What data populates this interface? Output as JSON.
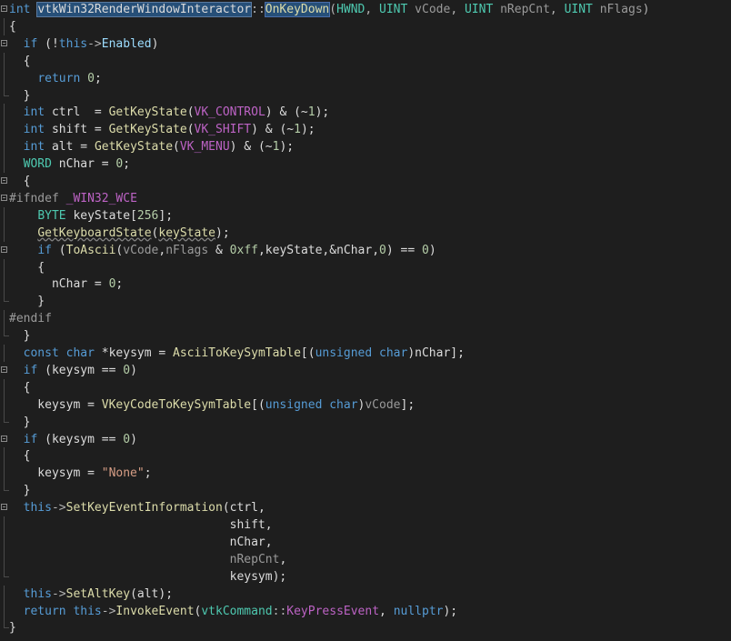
{
  "lines": [
    [
      [
        "kw",
        "int"
      ],
      [
        "plain",
        " "
      ],
      [
        "hlc",
        "vtkWin32RenderWindowInteractor"
      ],
      [
        "op",
        "::"
      ],
      [
        "hlf",
        "OnKeyDown"
      ],
      [
        "op",
        "("
      ],
      [
        "type",
        "HWND"
      ],
      [
        "op",
        ", "
      ],
      [
        "type",
        "UINT"
      ],
      [
        "param",
        " vCode"
      ],
      [
        "op",
        ", "
      ],
      [
        "type",
        "UINT"
      ],
      [
        "param",
        " nRepCnt"
      ],
      [
        "op",
        ", "
      ],
      [
        "type",
        "UINT"
      ],
      [
        "param",
        " nFlags"
      ],
      [
        "op",
        ")"
      ]
    ],
    [
      [
        "plain",
        "{"
      ]
    ],
    [
      [
        "plain",
        "  "
      ],
      [
        "kw",
        "if"
      ],
      [
        "plain",
        " (!"
      ],
      [
        "kw",
        "this"
      ],
      [
        "op",
        "->"
      ],
      [
        "var",
        "Enabled"
      ],
      [
        "plain",
        ")"
      ]
    ],
    [
      [
        "plain",
        "  {"
      ]
    ],
    [
      [
        "plain",
        "    "
      ],
      [
        "kw",
        "return"
      ],
      [
        "plain",
        " "
      ],
      [
        "num",
        "0"
      ],
      [
        "plain",
        ";"
      ]
    ],
    [
      [
        "plain",
        "  }"
      ]
    ],
    [
      [
        "plain",
        "  "
      ],
      [
        "kw",
        "int"
      ],
      [
        "plain",
        " ctrl  = "
      ],
      [
        "fn",
        "GetKeyState"
      ],
      [
        "plain",
        "("
      ],
      [
        "macro",
        "VK_CONTROL"
      ],
      [
        "plain",
        ") & (~"
      ],
      [
        "num",
        "1"
      ],
      [
        "plain",
        ");"
      ]
    ],
    [
      [
        "plain",
        "  "
      ],
      [
        "kw",
        "int"
      ],
      [
        "plain",
        " shift = "
      ],
      [
        "fn",
        "GetKeyState"
      ],
      [
        "plain",
        "("
      ],
      [
        "macro",
        "VK_SHIFT"
      ],
      [
        "plain",
        ") & (~"
      ],
      [
        "num",
        "1"
      ],
      [
        "plain",
        ");"
      ]
    ],
    [
      [
        "plain",
        "  "
      ],
      [
        "kw",
        "int"
      ],
      [
        "plain",
        " alt = "
      ],
      [
        "fn",
        "GetKeyState"
      ],
      [
        "plain",
        "("
      ],
      [
        "macro",
        "VK_MENU"
      ],
      [
        "plain",
        ") & (~"
      ],
      [
        "num",
        "1"
      ],
      [
        "plain",
        ");"
      ]
    ],
    [
      [
        "plain",
        "  "
      ],
      [
        "type",
        "WORD"
      ],
      [
        "plain",
        " nChar = "
      ],
      [
        "num",
        "0"
      ],
      [
        "plain",
        ";"
      ]
    ],
    [
      [
        "plain",
        "  {"
      ]
    ],
    [
      [
        "pp",
        "#ifndef"
      ],
      [
        "plain",
        " "
      ],
      [
        "macro",
        "_WIN32_WCE"
      ]
    ],
    [
      [
        "plain",
        "    "
      ],
      [
        "type",
        "BYTE"
      ],
      [
        "plain",
        " keyState["
      ],
      [
        "num",
        "256"
      ],
      [
        "plain",
        "];"
      ]
    ],
    [
      [
        "plain",
        "    "
      ],
      [
        "sq",
        "GetKeyboardState"
      ],
      [
        "plain",
        "("
      ],
      [
        "sq",
        "keyState"
      ],
      [
        "plain",
        ");"
      ]
    ],
    [
      [
        "plain",
        "    "
      ],
      [
        "kw",
        "if"
      ],
      [
        "plain",
        " ("
      ],
      [
        "fn",
        "ToAscii"
      ],
      [
        "plain",
        "("
      ],
      [
        "param",
        "vCode"
      ],
      [
        "plain",
        ","
      ],
      [
        "param",
        "nFlags"
      ],
      [
        "plain",
        " & "
      ],
      [
        "num",
        "0xff"
      ],
      [
        "plain",
        ",keyState,&nChar,"
      ],
      [
        "num",
        "0"
      ],
      [
        "plain",
        ") == "
      ],
      [
        "num",
        "0"
      ],
      [
        "plain",
        ")"
      ]
    ],
    [
      [
        "plain",
        "    {"
      ]
    ],
    [
      [
        "plain",
        "      nChar = "
      ],
      [
        "num",
        "0"
      ],
      [
        "plain",
        ";"
      ]
    ],
    [
      [
        "plain",
        "    }"
      ]
    ],
    [
      [
        "pp",
        "#endif"
      ]
    ],
    [
      [
        "plain",
        "  }"
      ]
    ],
    [
      [
        "plain",
        "  "
      ],
      [
        "kw",
        "const"
      ],
      [
        "plain",
        " "
      ],
      [
        "kw",
        "char"
      ],
      [
        "plain",
        " *keysym = "
      ],
      [
        "fn",
        "AsciiToKeySymTable"
      ],
      [
        "plain",
        "[("
      ],
      [
        "kw",
        "unsigned char"
      ],
      [
        "plain",
        ")"
      ],
      [
        "plain",
        "nChar];"
      ]
    ],
    [
      [
        "plain",
        "  "
      ],
      [
        "kw",
        "if"
      ],
      [
        "plain",
        " (keysym == "
      ],
      [
        "num",
        "0"
      ],
      [
        "plain",
        ")"
      ]
    ],
    [
      [
        "plain",
        "  {"
      ]
    ],
    [
      [
        "plain",
        "    keysym = "
      ],
      [
        "fn",
        "VKeyCodeToKeySymTable"
      ],
      [
        "plain",
        "[("
      ],
      [
        "kw",
        "unsigned char"
      ],
      [
        "plain",
        ")"
      ],
      [
        "param",
        "vCode"
      ],
      [
        "plain",
        "];"
      ]
    ],
    [
      [
        "plain",
        "  }"
      ]
    ],
    [
      [
        "plain",
        "  "
      ],
      [
        "kw",
        "if"
      ],
      [
        "plain",
        " (keysym == "
      ],
      [
        "num",
        "0"
      ],
      [
        "plain",
        ")"
      ]
    ],
    [
      [
        "plain",
        "  {"
      ]
    ],
    [
      [
        "plain",
        "    keysym = "
      ],
      [
        "str",
        "\"None\""
      ],
      [
        "plain",
        ";"
      ]
    ],
    [
      [
        "plain",
        "  }"
      ]
    ],
    [
      [
        "plain",
        "  "
      ],
      [
        "kw",
        "this"
      ],
      [
        "op",
        "->"
      ],
      [
        "fn",
        "SetKeyEventInformation"
      ],
      [
        "plain",
        "(ctrl,"
      ]
    ],
    [
      [
        "plain",
        "                               shift,"
      ]
    ],
    [
      [
        "plain",
        "                               nChar,"
      ]
    ],
    [
      [
        "plain",
        "                               "
      ],
      [
        "param",
        "nRepCnt"
      ],
      [
        "plain",
        ","
      ]
    ],
    [
      [
        "plain",
        "                               keysym);"
      ]
    ],
    [
      [
        "plain",
        "  "
      ],
      [
        "kw",
        "this"
      ],
      [
        "op",
        "->"
      ],
      [
        "fn",
        "SetAltKey"
      ],
      [
        "plain",
        "(alt);"
      ]
    ],
    [
      [
        "plain",
        "  "
      ],
      [
        "kw",
        "return"
      ],
      [
        "plain",
        " "
      ],
      [
        "kw",
        "this"
      ],
      [
        "op",
        "->"
      ],
      [
        "fn",
        "InvokeEvent"
      ],
      [
        "plain",
        "("
      ],
      [
        "type",
        "vtkCommand"
      ],
      [
        "op",
        "::"
      ],
      [
        "macro",
        "KeyPressEvent"
      ],
      [
        "plain",
        ", "
      ],
      [
        "kw",
        "nullptr"
      ],
      [
        "plain",
        ");"
      ]
    ],
    [
      [
        "plain",
        "}"
      ]
    ]
  ],
  "gutter": [
    "fold-open",
    "line",
    "fold-open",
    "line",
    "line",
    "end",
    "line",
    "line",
    "line",
    "line",
    "fold-open",
    "fold-open",
    "line",
    "line",
    "fold-open",
    "line",
    "line",
    "end",
    "line",
    "end",
    "line",
    "fold-open",
    "line",
    "line",
    "end",
    "fold-open",
    "line",
    "line",
    "end",
    "fold-open",
    "line",
    "line",
    "line",
    "end",
    "line",
    "line",
    "end"
  ]
}
